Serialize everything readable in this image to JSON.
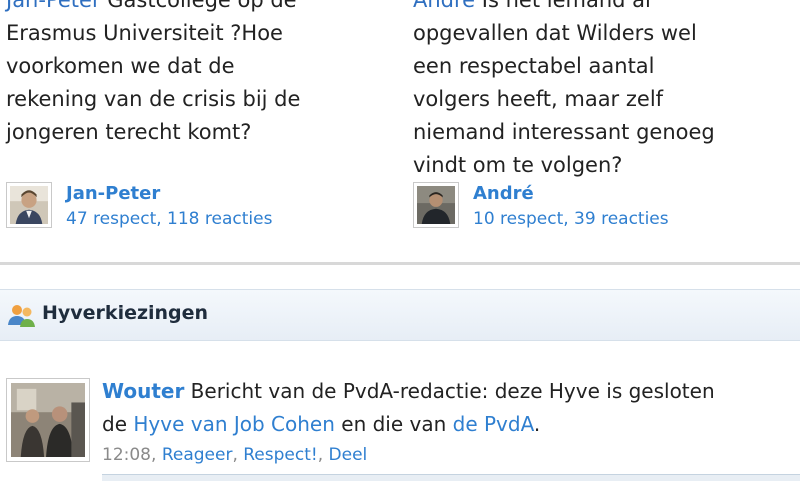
{
  "questions": [
    {
      "lines": [
        "Jan-Peter Gastcollege op de",
        "Erasmus Universiteit ?Hoe",
        "voorkomen we dat de",
        "rekening van de crisis bij de",
        "jongeren terecht komt?"
      ],
      "author": "Jan-Peter",
      "meta": "47 respect, 118 reacties"
    },
    {
      "lines": [
        "André Is het iemand al",
        "opgevallen dat Wilders wel",
        "een respectabel aantal",
        "volgers heeft, maar zelf",
        "niemand interessant genoeg",
        "vindt om te volgen?"
      ],
      "author": "André",
      "meta": "10 respect, 39 reacties"
    }
  ],
  "section": {
    "title": "Hyverkiezingen",
    "icon": "people-icon"
  },
  "post": {
    "author": "Wouter",
    "line1_text": " Bericht van de PvdA-redactie: deze Hyve is gesloten",
    "line2_prefix": "de ",
    "link1": "Hyve van Job Cohen",
    "line2_mid": " en die van ",
    "link2": "de PvdA",
    "line2_suffix": ".",
    "time": "12:08",
    "sep": ", ",
    "actions": [
      "Reageer",
      "Respect!",
      "Deel"
    ]
  },
  "colors": {
    "link": "#2f7fd0",
    "text": "#222222",
    "meta": "#8a8a8a"
  }
}
